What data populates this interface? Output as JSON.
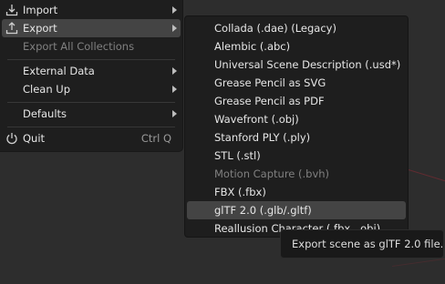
{
  "file_menu": {
    "items": [
      {
        "label": "Import",
        "icon": "import-icon"
      },
      {
        "label": "Export",
        "icon": "export-icon"
      },
      {
        "label": "Export All Collections"
      },
      {
        "label": "External Data"
      },
      {
        "label": "Clean Up"
      },
      {
        "label": "Defaults"
      },
      {
        "label": "Quit",
        "icon": "power-icon",
        "shortcut": "Ctrl Q"
      }
    ]
  },
  "export_submenu": {
    "items": [
      {
        "label": "Collada (.dae) (Legacy)"
      },
      {
        "label": "Alembic (.abc)"
      },
      {
        "label": "Universal Scene Description (.usd*)"
      },
      {
        "label": "Grease Pencil as SVG"
      },
      {
        "label": "Grease Pencil as PDF"
      },
      {
        "label": "Wavefront (.obj)"
      },
      {
        "label": "Stanford PLY (.ply)"
      },
      {
        "label": "STL (.stl)"
      },
      {
        "label": "Motion Capture (.bvh)"
      },
      {
        "label": "FBX (.fbx)"
      },
      {
        "label": "glTF 2.0 (.glb/.gltf)"
      },
      {
        "label": "Reallusion Character (.fbx, .obj)"
      }
    ]
  },
  "tooltip": {
    "text": "Export scene as glTF 2.0 file."
  },
  "colors": {
    "menu_bg": "#1e1e1e",
    "highlight": "#444444",
    "disabled_text": "#808080",
    "viewport_bg": "#2d2d2d",
    "x_axis_line": "#8a2a33"
  }
}
